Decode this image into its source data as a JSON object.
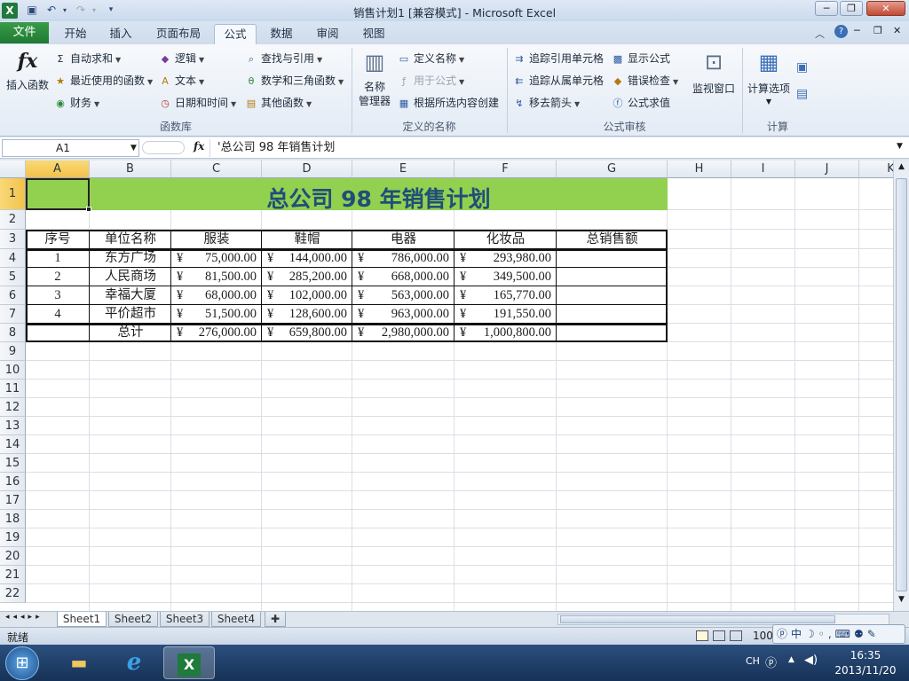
{
  "window": {
    "title": "销售计划1 [兼容模式] - Microsoft Excel"
  },
  "ribbon_tabs": [
    "文件",
    "开始",
    "插入",
    "页面布局",
    "公式",
    "数据",
    "审阅",
    "视图"
  ],
  "ribbon": {
    "insert_function": "插入函数",
    "autosum": "自动求和",
    "recent": "最近使用的函数",
    "financial": "财务",
    "logical": "逻辑",
    "text": "文本",
    "datetime": "日期和时间",
    "lookup": "查找与引用",
    "math": "数学和三角函数",
    "other": "其他函数",
    "group_library": "函数库",
    "name_manager_1": "名称",
    "name_manager_2": "管理器",
    "define_name": "定义名称",
    "use_in_formula": "用于公式",
    "create_from_sel": "根据所选内容创建",
    "group_names": "定义的名称",
    "trace_prec": "追踪引用单元格",
    "trace_dep": "追踪从属单元格",
    "remove_arrows": "移去箭头",
    "show_formulas": "显示公式",
    "error_check": "错误检查",
    "eval_formula": "公式求值",
    "group_audit": "公式审核",
    "watch": "监视窗口",
    "calc_options": "计算选项",
    "group_calc": "计算"
  },
  "formula_bar": {
    "name_box": "A1",
    "fx": "fx",
    "content": "'总公司 98 年销售计划"
  },
  "columns": [
    "A",
    "B",
    "C",
    "D",
    "E",
    "F",
    "G",
    "H",
    "I",
    "J",
    "K"
  ],
  "rows": [
    "1",
    "2",
    "3",
    "4",
    "5",
    "6",
    "7",
    "8",
    "9",
    "10",
    "11",
    "12",
    "13",
    "14",
    "15",
    "16",
    "17",
    "18",
    "19",
    "20",
    "21",
    "22"
  ],
  "sheet": {
    "title": "总公司 98 年销售计划",
    "headers": [
      "序号",
      "单位名称",
      "服装",
      "鞋帽",
      "电器",
      "化妆品",
      "总销售额"
    ],
    "data": [
      [
        "1",
        "东方广场",
        "75,000.00",
        "144,000.00",
        "786,000.00",
        "293,980.00"
      ],
      [
        "2",
        "人民商场",
        "81,500.00",
        "285,200.00",
        "668,000.00",
        "349,500.00"
      ],
      [
        "3",
        "幸福大厦",
        "68,000.00",
        "102,000.00",
        "563,000.00",
        "165,770.00"
      ],
      [
        "4",
        "平价超市",
        "51,500.00",
        "128,600.00",
        "963,000.00",
        "191,550.00"
      ]
    ],
    "total_label": "总计",
    "totals": [
      "276,000.00",
      "659,800.00",
      "2,980,000.00",
      "1,000,800.00"
    ],
    "currency": "¥"
  },
  "sheet_tabs": [
    "Sheet1",
    "Sheet2",
    "Sheet3",
    "Sheet4"
  ],
  "status": {
    "ready": "就绪",
    "zoom": "100"
  },
  "taskbar": {
    "lang": "CH",
    "time": "16:35",
    "date": "2013/11/20"
  },
  "colors": {
    "title_fill": "#92d050",
    "title_text": "#1f4e79",
    "file_tab": "#1e7a32"
  }
}
